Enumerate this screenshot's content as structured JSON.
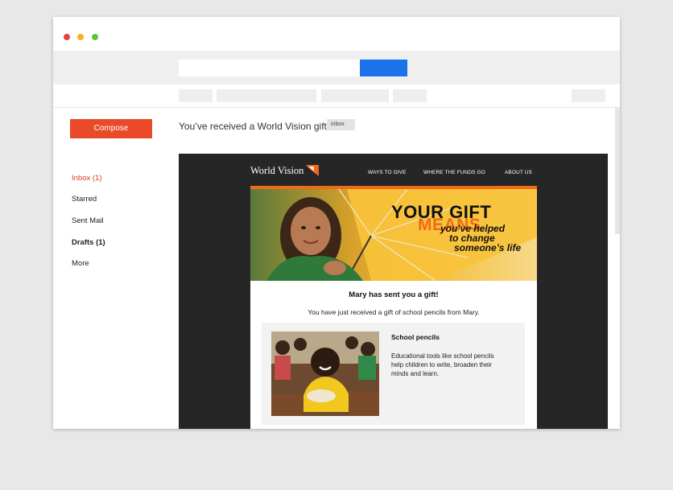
{
  "window": {
    "controls": [
      "close",
      "minimize",
      "maximize"
    ]
  },
  "sidebar": {
    "compose_label": "Compose",
    "items": [
      {
        "label": "Inbox (1)"
      },
      {
        "label": "Starred"
      },
      {
        "label": "Sent Mail"
      },
      {
        "label": "Drafts (1)"
      },
      {
        "label": "More"
      }
    ]
  },
  "message": {
    "subject": "You’ve received a World Vision gift",
    "tag": "inbox"
  },
  "email": {
    "logo_text": "World Vision",
    "nav": [
      "WAYS TO GIVE",
      "WHERE THE FUNDS GO",
      "ABOUT US"
    ],
    "hero": {
      "line1": "YOUR GIFT",
      "line2": "MEANS",
      "line3": "you’ve helped",
      "line4": "to change",
      "line5": "someone’s life"
    },
    "gift_title": "Mary has sent you a gift!",
    "gift_subtitle": "You have just received a gift of school pencils from Mary.",
    "card": {
      "title": "School pencils",
      "description": "Educational tools like school pencils help children to write, broaden their minds and learn."
    }
  },
  "colors": {
    "compose": "#ea4a2a",
    "search_button": "#1a73e8",
    "active_nav": "#d93a1f",
    "brand_orange": "#ee6b1a",
    "email_bg": "#262626"
  }
}
